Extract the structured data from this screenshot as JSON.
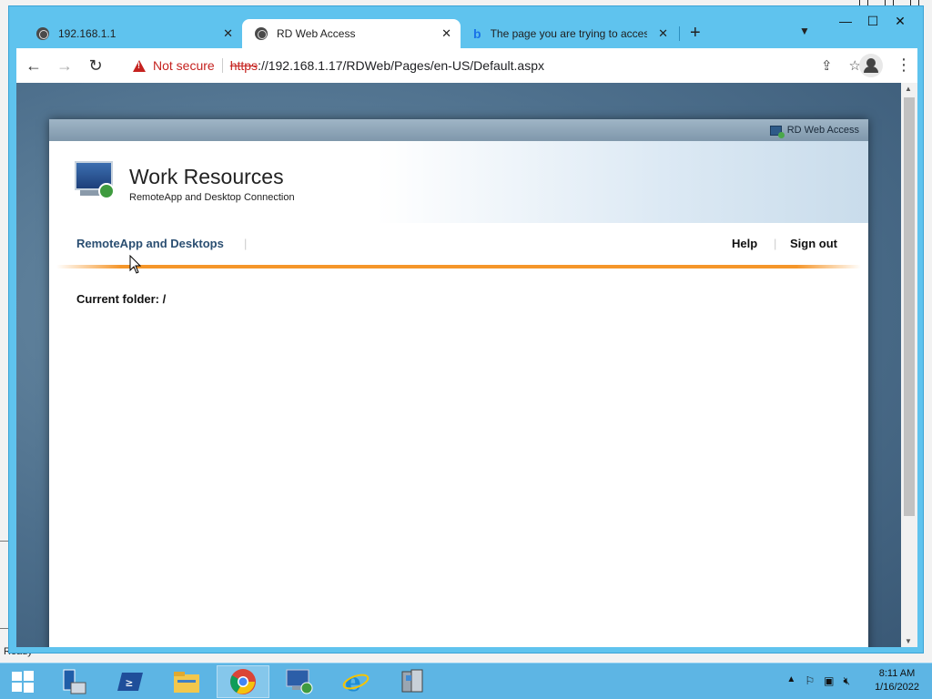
{
  "tabs": [
    {
      "title": "192.168.1.1",
      "active": false,
      "favicon": "globe-icon"
    },
    {
      "title": "RD Web Access",
      "active": true,
      "favicon": "globe-icon"
    },
    {
      "title": "The page you are trying to acces",
      "active": false,
      "favicon": "bing-icon"
    }
  ],
  "address_bar": {
    "security_label": "Not secure",
    "scheme": "https",
    "url_rest": "://192.168.1.17/RDWeb/Pages/en-US/Default.aspx"
  },
  "rdweb": {
    "topbar_label": "RD Web Access",
    "title": "Work Resources",
    "subtitle": "RemoteApp and Desktop Connection",
    "nav_left": "RemoteApp and Desktops",
    "nav_sep": "|",
    "help": "Help",
    "sign_out": "Sign out",
    "current_folder": "Current folder: /"
  },
  "behind_window": {
    "status": "Ready"
  },
  "taskbar": {
    "items": [
      "start-button",
      "server-manager-icon",
      "powershell-icon",
      "file-explorer-icon",
      "chrome-icon",
      "remote-desktop-icon",
      "internet-explorer-icon",
      "rdweb-tools-icon"
    ],
    "time": "8:11 AM",
    "date": "1/16/2022"
  },
  "colors": {
    "chrome_frame": "#5fc3ee",
    "warning_red": "#c5221f",
    "rd_link": "#2b4f72",
    "accent_orange": "#f5962a",
    "taskbar": "#5db5e4"
  }
}
